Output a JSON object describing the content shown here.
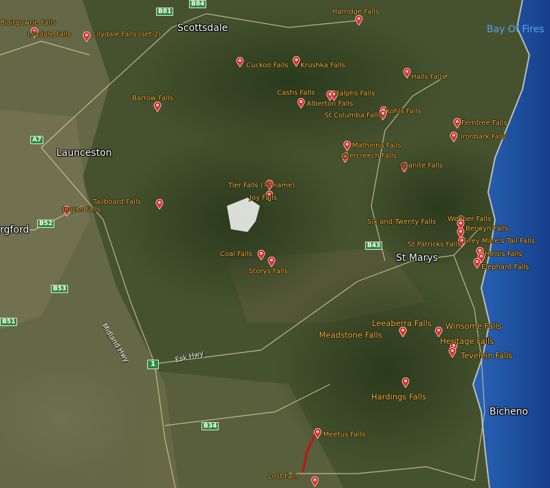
{
  "map": {
    "towns": [
      {
        "id": "scottsdale",
        "label": "Scottsdale"
      },
      {
        "id": "launceston",
        "label": "Launceston"
      },
      {
        "id": "longford",
        "label": "rgford"
      },
      {
        "id": "st-marys",
        "label": "St Marys"
      },
      {
        "id": "bicheno",
        "label": "Bicheno"
      }
    ],
    "water": {
      "bay_label": "Bay Of Fires"
    },
    "roads": {
      "shields": [
        "B81",
        "B84",
        "A7",
        "B52",
        "B53",
        "B51",
        "B43",
        "B34",
        "1"
      ],
      "names": {
        "midland": "Midland Hwy",
        "esk": "Esk Hwy"
      }
    },
    "falls": [
      "Blairgowrie Falls",
      "Lilydale Falls",
      "Lilydale Falls (set 2)",
      "Harridge Falls",
      "Cuckoo Falls",
      "Krushka Falls",
      "Halls Falls",
      "Barrow Falls",
      "Cashs Falls",
      "Ralphs Falls",
      "Alberton Falls",
      "Kohls Falls",
      "St Columba Falls",
      "Ferntree Falls",
      "Ironbark Falls",
      "Mathinna Falls",
      "Evercreech Falls",
      "Granite Falls",
      "Tier Falls (?? name)",
      "Joy Falls",
      "Tailboard Falls",
      "Logan Falls",
      "Webber Falls",
      "Six and Twenty Falls",
      "Berwyn Falls",
      "St Patricks Falls",
      "Grey Mare's Tail Falls",
      "Heisis Falls",
      "Elephant Falls",
      "Coal Falls",
      "Storys Falls",
      "Leeaberra Falls",
      "Winsome Falls",
      "Meadstone Falls",
      "Heritage Falls",
      "Tevelein Falls",
      "Hardings Falls",
      "Meetus Falls",
      "Lost Falls"
    ],
    "colors": {
      "falls_label": "#f0b43c",
      "pin": "#d9312b",
      "track": "#c0121a",
      "sea": "#1f55a8",
      "shield": "#2f8a3c"
    }
  }
}
